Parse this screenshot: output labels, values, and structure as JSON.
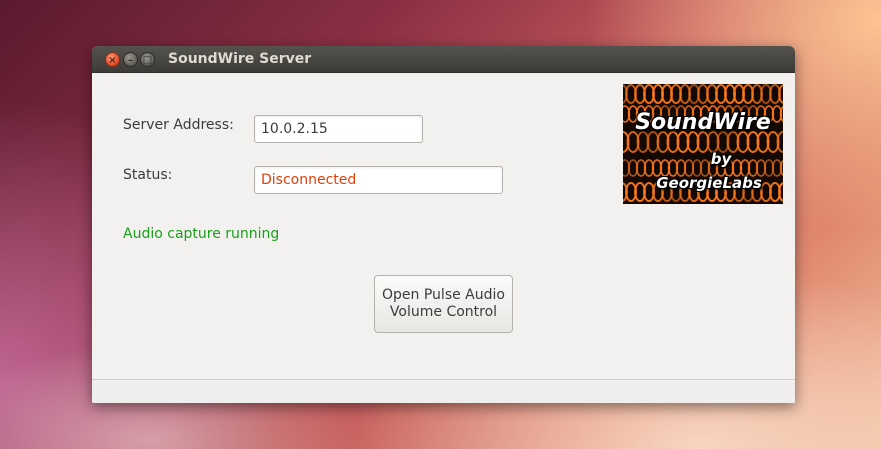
{
  "window": {
    "title": "SoundWire Server",
    "close_glyph": "×",
    "minimize_glyph": "–",
    "maximize_glyph": "□"
  },
  "form": {
    "server_address_label": "Server Address:",
    "server_address_value": "10.0.2.15",
    "status_label": "Status:",
    "status_value": "Disconnected",
    "status_color": "#e0400a"
  },
  "audio_status": {
    "text": "Audio capture running",
    "color": "#18a018"
  },
  "pulse_button": {
    "line1": "Open Pulse Audio",
    "line2": "Volume Control"
  },
  "logo": {
    "line1": "SoundWire",
    "line2": "by",
    "line3": "GeorgieLabs",
    "coil_color": "#ff7a1a"
  }
}
